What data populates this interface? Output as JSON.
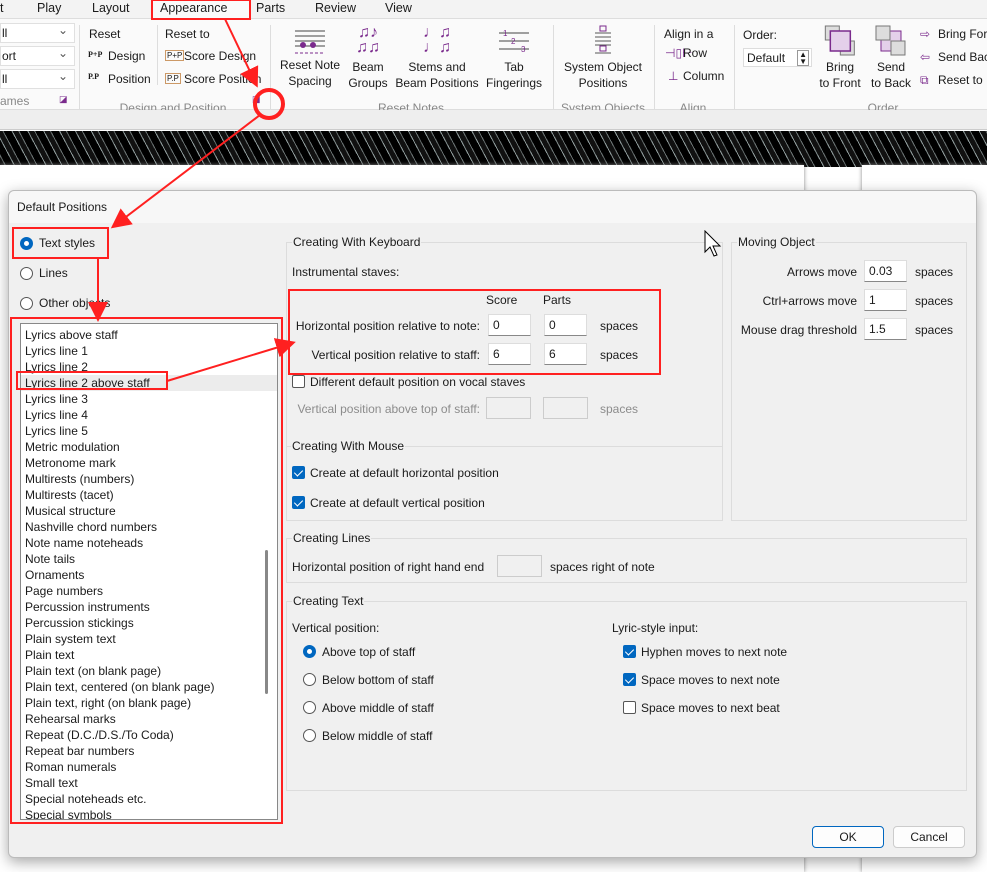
{
  "ribbon": {
    "tabs": [
      "t",
      "Play",
      "Layout",
      "Appearance",
      "Parts",
      "Review",
      "View"
    ],
    "active_tab": "Appearance",
    "left_dropdowns": [
      "ll",
      "ort",
      "ll"
    ],
    "left_group_label": "ames",
    "design": {
      "reset": "Reset",
      "design": "Design",
      "position": "Position",
      "reset_to": "Reset to",
      "score_design": "Score Design",
      "score_position": "Score Position",
      "label": "Design and Position"
    },
    "reset_notes": {
      "note_spacing": [
        "Reset Note",
        "Spacing"
      ],
      "beam_groups": [
        "Beam",
        "Groups"
      ],
      "stems": [
        "Stems and",
        "Beam Positions"
      ],
      "tab": [
        "Tab",
        "Fingerings"
      ],
      "label": "Reset Notes"
    },
    "system_objects": {
      "button": [
        "System Object",
        "Positions"
      ],
      "label": "System Objects"
    },
    "align": {
      "title": "Align in a",
      "row": "Row",
      "column": "Column",
      "label": "Align"
    },
    "order": {
      "title": "Order:",
      "value": "Default",
      "bring_front": [
        "Bring",
        "to Front"
      ],
      "send_back": [
        "Send",
        "to Back"
      ],
      "bring_forward": "Bring For",
      "send_backward": "Send Bac",
      "reset_to": "Reset to I",
      "label": "Order"
    }
  },
  "dialog": {
    "title": "Default Positions",
    "radios": [
      {
        "label": "Text styles",
        "checked": true
      },
      {
        "label": "Lines",
        "checked": false
      },
      {
        "label": "Other objects",
        "checked": false
      }
    ],
    "list": {
      "items": [
        "Lyrics above staff",
        "Lyrics line 1",
        "Lyrics line 2",
        "Lyrics line 2 above staff",
        "Lyrics line 3",
        "Lyrics line 4",
        "Lyrics line 5",
        "Metric modulation",
        "Metronome mark",
        "Multirests (numbers)",
        "Multirests (tacet)",
        "Musical structure",
        "Nashville chord numbers",
        "Note name noteheads",
        "Note tails",
        "Ornaments",
        "Page numbers",
        "Percussion instruments",
        "Percussion stickings",
        "Plain system text",
        "Plain text",
        "Plain text (on blank page)",
        "Plain text, centered (on blank page)",
        "Plain text, right (on blank page)",
        "Rehearsal marks",
        "Repeat (D.C./D.S./To Coda)",
        "Repeat bar numbers",
        "Roman numerals",
        "Small text",
        "Special noteheads etc.",
        "Special symbols"
      ],
      "selected": "Lyrics line 2 above staff"
    },
    "keyboard": {
      "legend": "Creating With Keyboard",
      "instrumental": "Instrumental staves:",
      "col_score": "Score",
      "col_parts": "Parts",
      "horizontal": {
        "label": "Horizontal position relative to note:",
        "score": "0",
        "parts": "0",
        "unit": "spaces"
      },
      "vertical": {
        "label": "Vertical position relative to staff:",
        "score": "6",
        "parts": "6",
        "unit": "spaces"
      },
      "vocal_checkbox": {
        "label": "Different default position on vocal staves",
        "checked": false
      },
      "vocal_vertical": {
        "label": "Vertical position above top of staff:",
        "score": "",
        "parts": "",
        "unit": "spaces"
      }
    },
    "mouse": {
      "legend": "Creating With Mouse",
      "horizontal": {
        "label": "Create at default horizontal position",
        "checked": true
      },
      "vertical": {
        "label": "Create at default vertical position",
        "checked": true
      }
    },
    "moving": {
      "legend": "Moving Object",
      "rows": [
        {
          "label": "Arrows move",
          "value": "0.03",
          "unit": "spaces"
        },
        {
          "label": "Ctrl+arrows move",
          "value": "1",
          "unit": "spaces"
        },
        {
          "label": "Mouse drag threshold",
          "value": "1.5",
          "unit": "spaces"
        }
      ]
    },
    "lines": {
      "legend": "Creating Lines",
      "label": "Horizontal position of right hand end",
      "value": "",
      "unit": "spaces right of note"
    },
    "text": {
      "legend": "Creating Text",
      "vertical_title": "Vertical position:",
      "vertical_options": [
        {
          "label": "Above top of staff",
          "checked": true
        },
        {
          "label": "Below bottom of staff",
          "checked": false
        },
        {
          "label": "Above middle of staff",
          "checked": false
        },
        {
          "label": "Below middle of staff",
          "checked": false
        }
      ],
      "lyric_title": "Lyric-style input:",
      "lyric_options": [
        {
          "label": "Hyphen moves to next note",
          "checked": true
        },
        {
          "label": "Space moves to next note",
          "checked": true
        },
        {
          "label": "Space moves to next beat",
          "checked": false
        }
      ]
    },
    "ok": "OK",
    "cancel": "Cancel"
  },
  "colors": {
    "accent": "#0067c0",
    "annotation": "#ff2020",
    "ribbon_icon": "#7a2a8c"
  }
}
